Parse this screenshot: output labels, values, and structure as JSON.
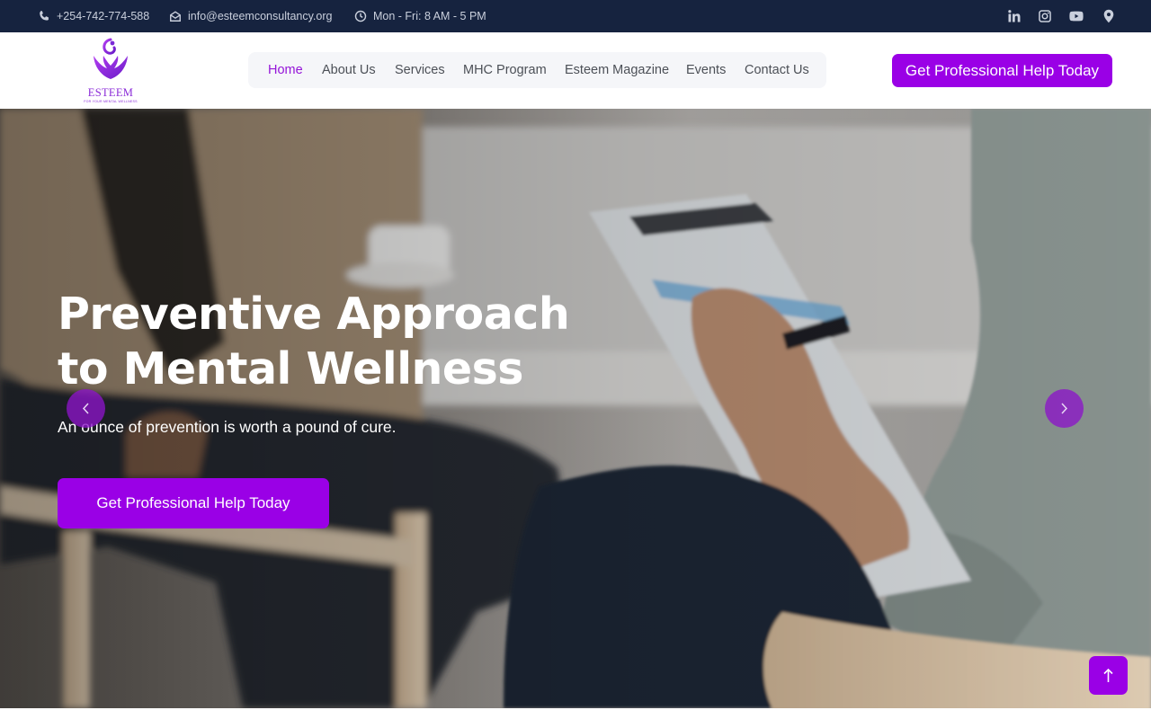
{
  "topbar": {
    "phone": "+254-742-774-588",
    "email": "info@esteemconsultancy.org",
    "hours": "Mon - Fri: 8 AM - 5 PM",
    "social": [
      "linkedin-icon",
      "instagram-icon",
      "youtube-icon",
      "map-pin-icon"
    ]
  },
  "header": {
    "logo_title": "ESTEEM",
    "logo_tagline": "FOR YOUR MENTAL WELLNESS",
    "nav": [
      {
        "label": "Home",
        "active": true
      },
      {
        "label": "About Us"
      },
      {
        "label": "Services"
      },
      {
        "label": "MHC Program"
      },
      {
        "label": "Esteem Magazine"
      },
      {
        "label": "Events"
      },
      {
        "label": "Contact Us"
      }
    ],
    "cta_label": "Get Professional Help Today"
  },
  "hero": {
    "title_line1": "Preventive Approach",
    "title_line2": "to Mental Wellness",
    "subtitle": "An ounce of prevention is worth a pound of cure.",
    "cta_label": "Get Professional Help Today"
  },
  "colors": {
    "accent": "#9a00e6",
    "topbar_bg": "#16233f",
    "nav_active": "#9515d9"
  }
}
